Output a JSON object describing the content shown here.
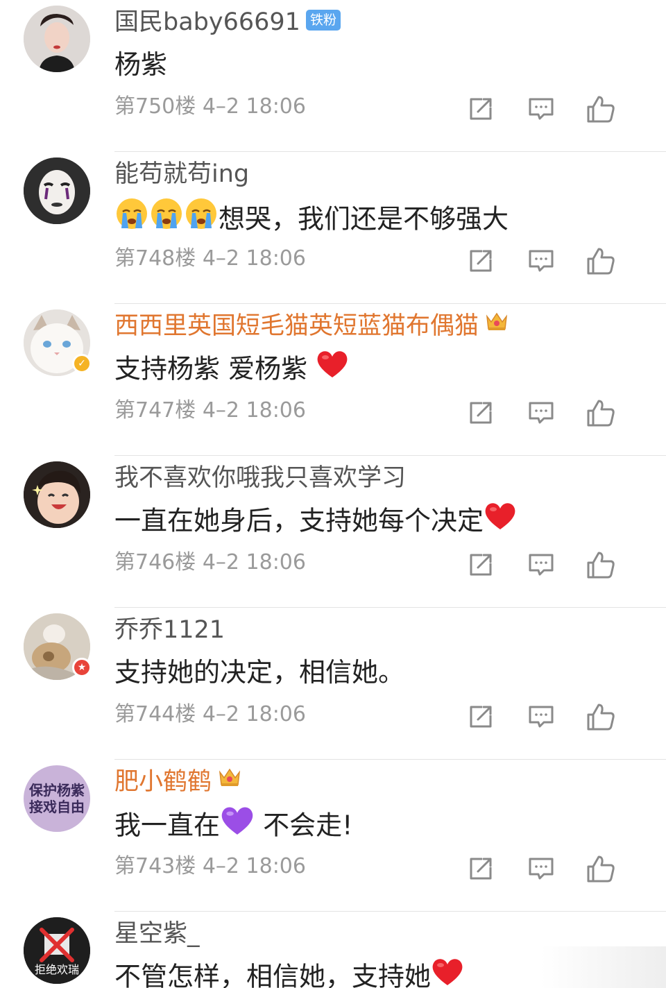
{
  "comments": [
    {
      "user": "国民baby66691",
      "badge": "铁粉",
      "text": "杨紫",
      "floor": "第750楼",
      "time": "4–2 18:06"
    },
    {
      "user": "能苟就苟ing",
      "text": "想哭，我们还是不够强大",
      "floor": "第748楼",
      "time": "4–2 18:06"
    },
    {
      "user": "西西里英国短毛猫英短蓝猫布偶猫",
      "text": "支持杨紫 爱杨紫",
      "floor": "第747楼",
      "time": "4–2 18:06"
    },
    {
      "user": "我不喜欢你哦我只喜欢学习",
      "text": "一直在她身后，支持她每个决定",
      "floor": "第746楼",
      "time": "4–2 18:06"
    },
    {
      "user": "乔乔1121",
      "text": "支持她的决定，相信她。",
      "floor": "第744楼",
      "time": "4–2 18:06"
    },
    {
      "user": "肥小鹤鹤",
      "text_part1": "我一直在",
      "text_part2": " 不会走!",
      "avatar_text_line1": "保护杨紫",
      "avatar_text_line2": "接戏自由",
      "floor": "第743楼",
      "time": "4–2 18:06"
    },
    {
      "user": "星空紫_",
      "text": "不管怎样，相信她，支持她",
      "avatar_text": "拒绝欢瑞"
    }
  ],
  "icons": {
    "repost": "repost-icon",
    "reply": "reply-icon",
    "like": "like-icon",
    "crying": "crying-emoji",
    "heart": "red-heart-emoji",
    "purple_heart": "purple-heart-emoji",
    "crown": "crown-icon"
  },
  "colors": {
    "vip_name": "#e0762f",
    "name": "#555555",
    "text": "#222222",
    "meta": "#9a9a9a",
    "fan_badge": "#5aa6ef"
  }
}
